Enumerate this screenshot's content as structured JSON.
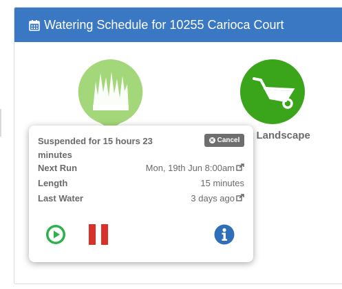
{
  "header": {
    "icon": "calendar-icon",
    "title": "Watering Schedule for 10255 Carioca Court"
  },
  "zones": [
    {
      "name": "lawn-zone",
      "icon": "grass-icon",
      "label": ""
    },
    {
      "name": "landscape-zone",
      "icon": "wheelbarrow-icon",
      "label": "et Landscape"
    }
  ],
  "popover": {
    "status": "Suspended for 15 hours 23 minutes",
    "cancel_label": "Cancel",
    "rows": [
      {
        "label": "Next Run",
        "value": "Mon, 19th Jun 8:00am",
        "icon": "external-link-icon"
      },
      {
        "label": "Length",
        "value": "15 minutes"
      },
      {
        "label": "Last Water",
        "value": "3 days ago",
        "icon": "external-link-icon"
      }
    ],
    "actions": [
      "play-icon",
      "pause-icon",
      "info-icon"
    ]
  },
  "colors": {
    "header": "#3a78c3",
    "lawn_green": "#a4d77a",
    "landscape_green": "#3aa51b",
    "play_green": "#2cb24b",
    "pause_red": "#d9302a",
    "info_blue": "#2f6fb8"
  }
}
